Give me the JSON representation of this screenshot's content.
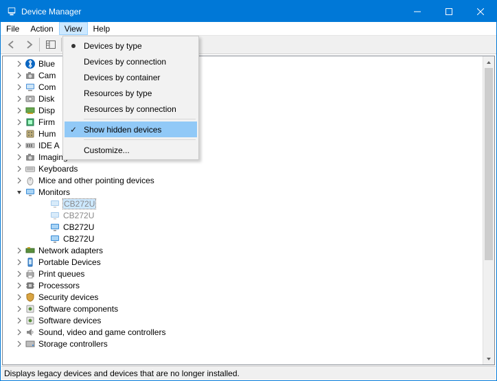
{
  "title": "Device Manager",
  "menubar": [
    "File",
    "Action",
    "View",
    "Help"
  ],
  "menubar_open_index": 2,
  "view_menu": {
    "devices_by_type": "Devices by type",
    "devices_by_connection": "Devices by connection",
    "devices_by_container": "Devices by container",
    "resources_by_type": "Resources by type",
    "resources_by_connection": "Resources by connection",
    "show_hidden": "Show hidden devices",
    "customize": "Customize..."
  },
  "tree_visible": [
    {
      "label": "Blue",
      "icon": "bluetooth",
      "expander": "closed",
      "indent": 1
    },
    {
      "label": "Cam",
      "icon": "camera",
      "expander": "closed",
      "indent": 1
    },
    {
      "label": "Com",
      "icon": "computer",
      "expander": "closed",
      "indent": 1
    },
    {
      "label": "Disk",
      "icon": "disk",
      "expander": "closed",
      "indent": 1
    },
    {
      "label": "Disp",
      "icon": "display-adapter",
      "expander": "closed",
      "indent": 1
    },
    {
      "label": "Firm",
      "icon": "firmware",
      "expander": "closed",
      "indent": 1
    },
    {
      "label": "Hum",
      "icon": "hid",
      "expander": "closed",
      "indent": 1
    },
    {
      "label": "IDE A",
      "icon": "ide",
      "expander": "closed",
      "indent": 1
    },
    {
      "label": "Imaging devices",
      "icon": "camera",
      "expander": "closed",
      "indent": 1
    },
    {
      "label": "Keyboards",
      "icon": "keyboard",
      "expander": "closed",
      "indent": 1
    },
    {
      "label": "Mice and other pointing devices",
      "icon": "mouse",
      "expander": "closed",
      "indent": 1
    },
    {
      "label": "Monitors",
      "icon": "monitor",
      "expander": "open",
      "indent": 1
    },
    {
      "label": "CB272U",
      "icon": "monitor",
      "expander": "none",
      "indent": 2,
      "faded": true,
      "selected": true
    },
    {
      "label": "CB272U",
      "icon": "monitor",
      "expander": "none",
      "indent": 2,
      "faded": true
    },
    {
      "label": "CB272U",
      "icon": "monitor",
      "expander": "none",
      "indent": 2
    },
    {
      "label": "CB272U",
      "icon": "monitor",
      "expander": "none",
      "indent": 2
    },
    {
      "label": "Network adapters",
      "icon": "network",
      "expander": "closed",
      "indent": 1
    },
    {
      "label": "Portable Devices",
      "icon": "portable",
      "expander": "closed",
      "indent": 1
    },
    {
      "label": "Print queues",
      "icon": "printer",
      "expander": "closed",
      "indent": 1
    },
    {
      "label": "Processors",
      "icon": "cpu",
      "expander": "closed",
      "indent": 1
    },
    {
      "label": "Security devices",
      "icon": "security",
      "expander": "closed",
      "indent": 1
    },
    {
      "label": "Software components",
      "icon": "software",
      "expander": "closed",
      "indent": 1
    },
    {
      "label": "Software devices",
      "icon": "software",
      "expander": "closed",
      "indent": 1
    },
    {
      "label": "Sound, video and game controllers",
      "icon": "sound",
      "expander": "closed",
      "indent": 1
    },
    {
      "label": "Storage controllers",
      "icon": "storage",
      "expander": "closed",
      "indent": 1
    }
  ],
  "status_text": "Displays legacy devices and devices that are no longer installed."
}
